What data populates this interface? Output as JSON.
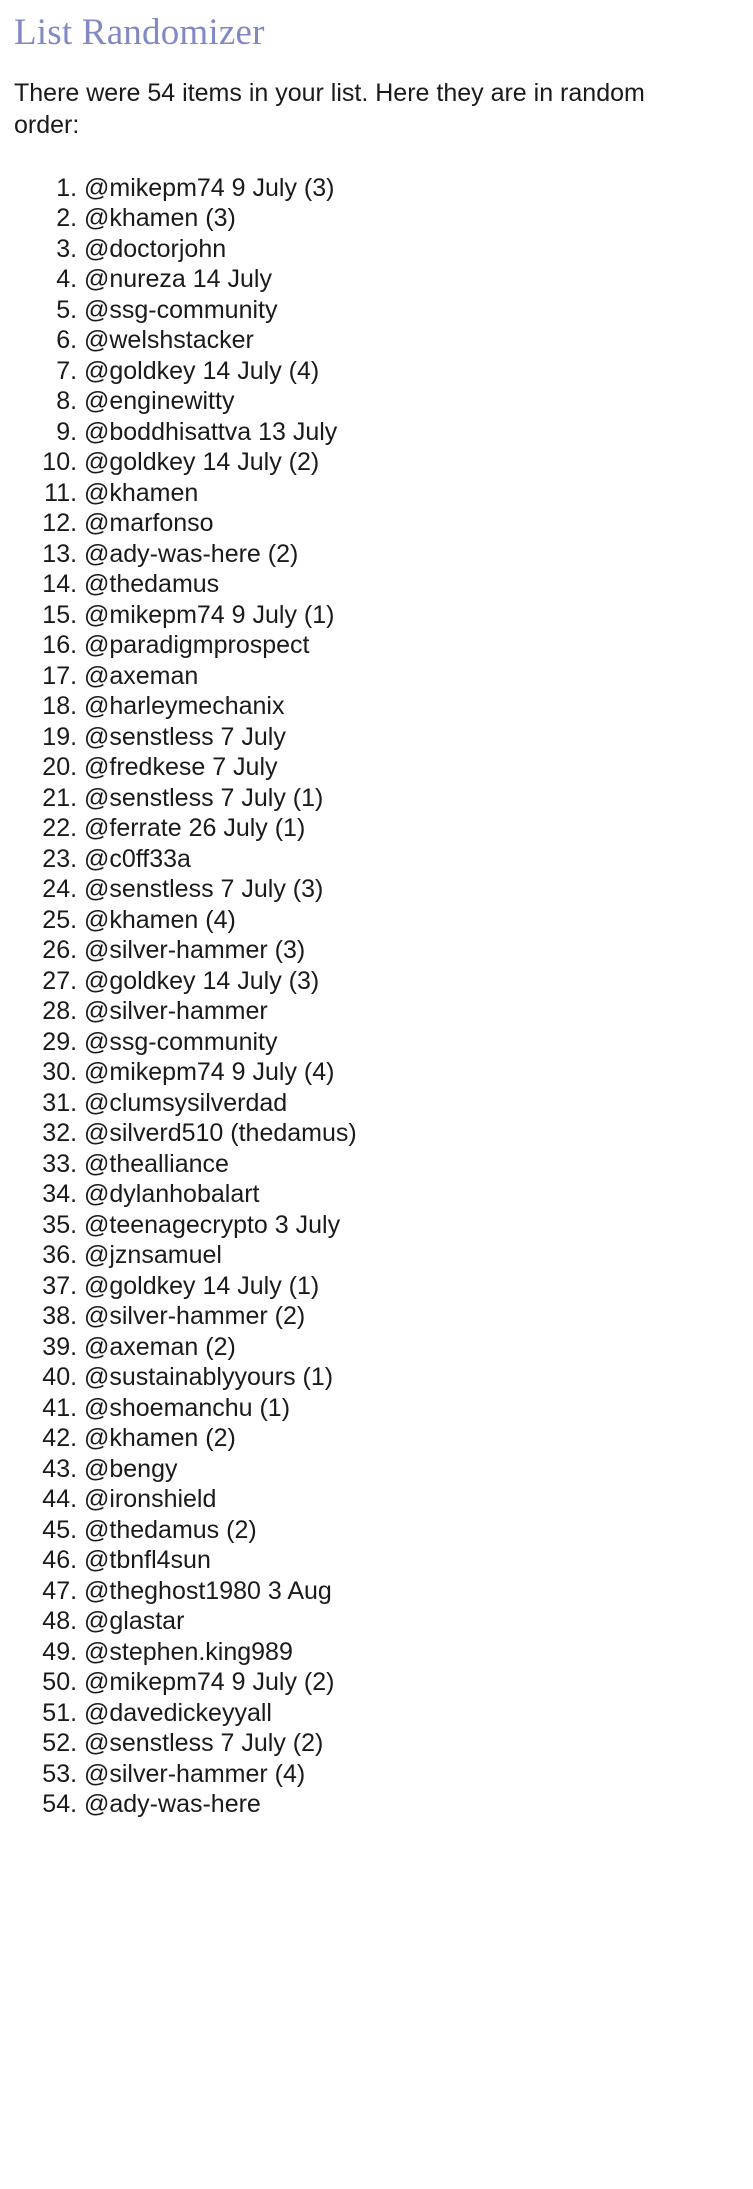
{
  "page": {
    "title": "List Randomizer",
    "intro": "There were 54 items in your list. Here they are in random order:",
    "item_count": 54,
    "title_color": "#8189c4",
    "text_color": "#1a1a1a",
    "background_color": "#ffffff"
  },
  "results": [
    "@mikepm74 9 July (3)",
    "@khamen (3)",
    "@doctorjohn",
    "@nureza 14 July",
    "@ssg-community",
    "@welshstacker",
    "@goldkey 14 July (4)",
    "@enginewitty",
    "@boddhisattva 13 July",
    "@goldkey 14 July (2)",
    "@khamen",
    "@marfonso",
    "@ady-was-here (2)",
    "@thedamus",
    "@mikepm74 9 July (1)",
    "@paradigmprospect",
    "@axeman",
    "@harleymechanix",
    "@senstless 7 July",
    "@fredkese 7 July",
    "@senstless 7 July (1)",
    "@ferrate 26 July (1)",
    "@c0ff33a",
    "@senstless 7 July (3)",
    "@khamen (4)",
    "@silver-hammer (3)",
    "@goldkey 14 July (3)",
    "@silver-hammer",
    "@ssg-community",
    "@mikepm74 9 July (4)",
    "@clumsysilverdad",
    "@silverd510 (thedamus)",
    "@thealliance",
    "@dylanhobalart",
    "@teenagecrypto 3 July",
    "@jznsamuel",
    "@goldkey 14 July (1)",
    "@silver-hammer (2)",
    "@axeman (2)",
    "@sustainablyyours (1)",
    "@shoemanchu (1)",
    "@khamen (2)",
    "@bengy",
    "@ironshield",
    "@thedamus (2)",
    "@tbnfl4sun",
    "@theghost1980 3 Aug",
    "@glastar",
    "@stephen.king989",
    "@mikepm74 9 July (2)",
    "@davedickeyyall",
    "@senstless 7 July (2)",
    "@silver-hammer (4)",
    "@ady-was-here"
  ]
}
